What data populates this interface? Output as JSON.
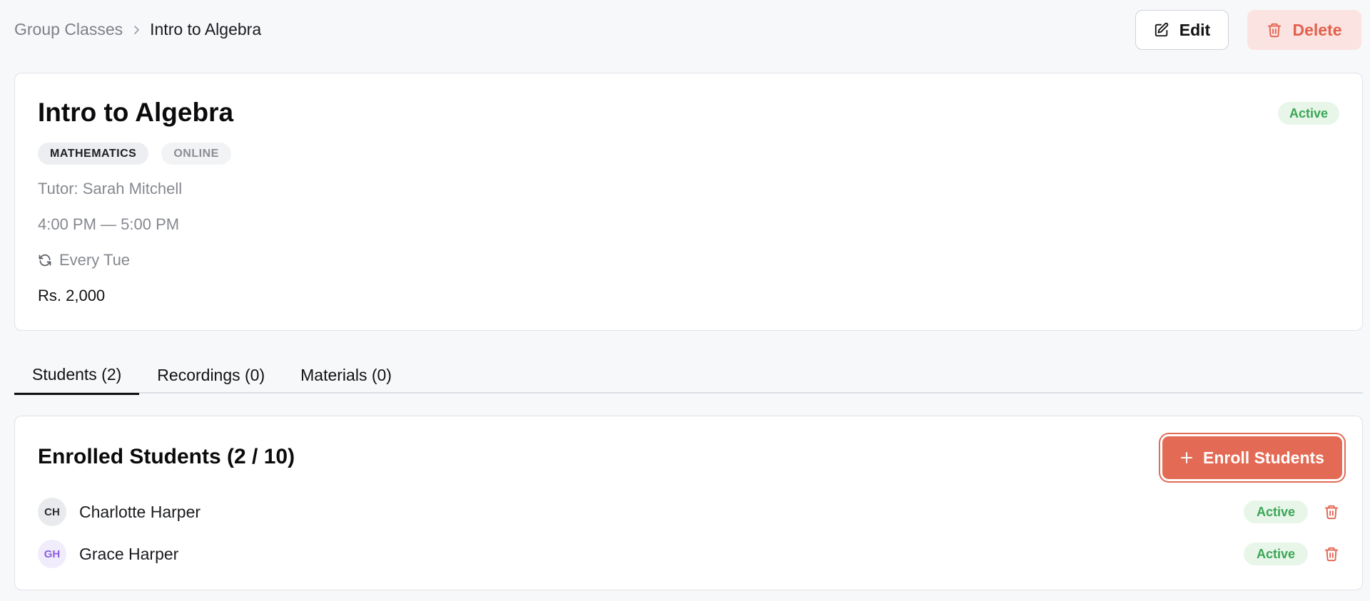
{
  "breadcrumb": {
    "parent": "Group Classes",
    "current": "Intro to Algebra"
  },
  "actions": {
    "edit_label": "Edit",
    "delete_label": "Delete"
  },
  "class": {
    "title": "Intro to Algebra",
    "status": "Active",
    "tags": [
      "MATHEMATICS",
      "ONLINE"
    ],
    "tutor": "Tutor: Sarah Mitchell",
    "time": "4:00 PM — 5:00 PM",
    "recurrence": "Every Tue",
    "price": "Rs. 2,000"
  },
  "tabs": [
    {
      "label": "Students (2)",
      "active": true
    },
    {
      "label": "Recordings (0)",
      "active": false
    },
    {
      "label": "Materials (0)",
      "active": false
    }
  ],
  "enrolled": {
    "title": "Enrolled Students (2 / 10)",
    "enroll_label": "Enroll Students",
    "students": [
      {
        "initials": "CH",
        "name": "Charlotte Harper",
        "status": "Active",
        "avatar_bg": "#e9eaed",
        "avatar_fg": "#2a2b30"
      },
      {
        "initials": "GH",
        "name": "Grace Harper",
        "status": "Active",
        "avatar_bg": "#f1ecfb",
        "avatar_fg": "#8a5fe0"
      }
    ]
  },
  "colors": {
    "accent": "#e36a55",
    "danger": "#e2604d",
    "success": "#3aa655",
    "success_bg": "#e8f6ea"
  },
  "icons": {
    "breadcrumb_separator": "chevron-right-icon",
    "edit": "pencil-square-icon",
    "delete": "trash-icon",
    "recurrence": "refresh-icon",
    "enroll": "plus-icon"
  }
}
